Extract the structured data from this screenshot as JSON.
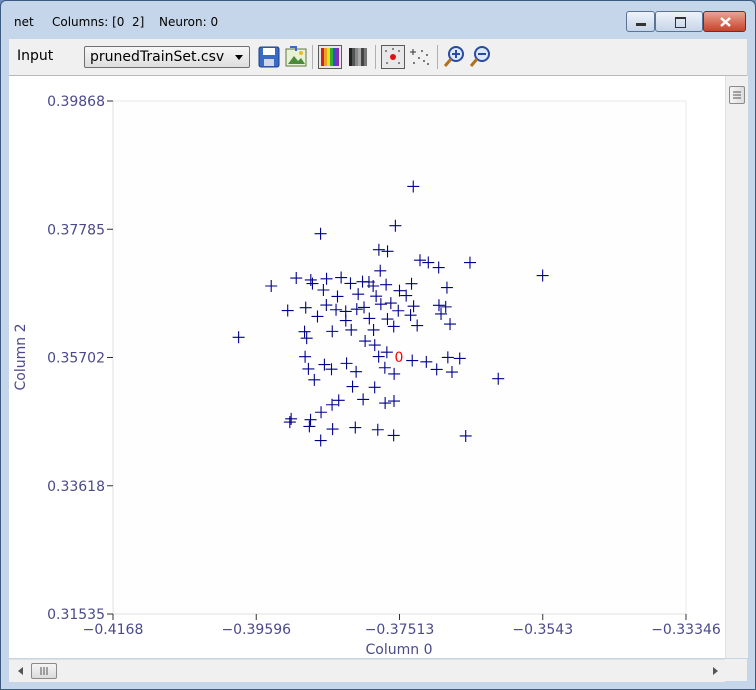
{
  "window": {
    "title_net": "net",
    "title_columns": "Columns: [0  2]",
    "title_neuron": "Neuron: 0"
  },
  "toolbar": {
    "input_label": "Input",
    "file_select_value": "prunedTrainSet.csv",
    "icons": [
      "save-icon",
      "export-image-icon",
      "color-map-icon",
      "grayscale-map-icon",
      "show-neuron-icon",
      "scatter-points-icon",
      "zoom-in-icon",
      "zoom-out-icon"
    ]
  },
  "colors": {
    "points": "#00008b",
    "neuron": "#ff0000",
    "axis_text": "#4a4a8a"
  },
  "chart_data": {
    "type": "scatter",
    "xlabel": "Column 0",
    "ylabel": "Column 2",
    "xlim": [
      -0.4168,
      -0.33346
    ],
    "ylim": [
      0.31535,
      0.39868
    ],
    "x_ticks": [
      "−0.4168",
      "−0.39596",
      "−0.37513",
      "−0.3543",
      "−0.33346"
    ],
    "y_ticks": [
      "0.39868",
      "0.37785",
      "0.35702",
      "0.33618",
      "0.31535"
    ],
    "grid": false,
    "marker": "+",
    "neuron": {
      "label": "0",
      "x": -0.3752,
      "y": 0.3571
    },
    "points": [
      [
        -0.37313,
        0.3848
      ],
      [
        -0.37573,
        0.37842
      ],
      [
        -0.38661,
        0.37712
      ],
      [
        -0.37813,
        0.37452
      ],
      [
        -0.37687,
        0.37426
      ],
      [
        -0.37094,
        0.37244
      ],
      [
        -0.37215,
        0.37282
      ],
      [
        -0.36943,
        0.37163
      ],
      [
        -0.36488,
        0.37243
      ],
      [
        -0.37793,
        0.3711
      ],
      [
        -0.35431,
        0.37033
      ],
      [
        -0.39379,
        0.36863
      ],
      [
        -0.39015,
        0.36992
      ],
      [
        -0.38803,
        0.36961
      ],
      [
        -0.38779,
        0.36902
      ],
      [
        -0.38574,
        0.3698
      ],
      [
        -0.38362,
        0.37
      ],
      [
        -0.38226,
        0.36905
      ],
      [
        -0.38051,
        0.36933
      ],
      [
        -0.37957,
        0.36928
      ],
      [
        -0.37896,
        0.36863
      ],
      [
        -0.37708,
        0.36885
      ],
      [
        -0.37513,
        0.36787
      ],
      [
        -0.37338,
        0.369
      ],
      [
        -0.36823,
        0.36837
      ],
      [
        -0.3862,
        0.36798
      ],
      [
        -0.38415,
        0.36693
      ],
      [
        -0.38114,
        0.3673
      ],
      [
        -0.37853,
        0.36698
      ],
      [
        -0.37416,
        0.36707
      ],
      [
        -0.38877,
        0.36511
      ],
      [
        -0.38577,
        0.36554
      ],
      [
        -0.38436,
        0.36477
      ],
      [
        -0.38295,
        0.3645
      ],
      [
        -0.38134,
        0.36487
      ],
      [
        -0.38029,
        0.36515
      ],
      [
        -0.37784,
        0.36568
      ],
      [
        -0.37639,
        0.36585
      ],
      [
        -0.37308,
        0.36535
      ],
      [
        -0.36939,
        0.3655
      ],
      [
        -0.36841,
        0.36524
      ],
      [
        -0.37531,
        0.36461
      ],
      [
        -0.39139,
        0.36464
      ],
      [
        -0.38706,
        0.36368
      ],
      [
        -0.38294,
        0.36301
      ],
      [
        -0.37952,
        0.36336
      ],
      [
        -0.37688,
        0.36326
      ],
      [
        -0.37352,
        0.36389
      ],
      [
        -0.36909,
        0.36409
      ],
      [
        -0.38894,
        0.36121
      ],
      [
        -0.38491,
        0.36126
      ],
      [
        -0.38215,
        0.3615
      ],
      [
        -0.3789,
        0.36149
      ],
      [
        -0.37597,
        0.36206
      ],
      [
        -0.37256,
        0.36221
      ],
      [
        -0.36778,
        0.36244
      ],
      [
        -0.39853,
        0.3603
      ],
      [
        -0.38863,
        0.36016
      ],
      [
        -0.38013,
        0.35969
      ],
      [
        -0.37873,
        0.35903
      ],
      [
        -0.38886,
        0.35714
      ],
      [
        -0.38605,
        0.35586
      ],
      [
        -0.38283,
        0.35606
      ],
      [
        -0.37816,
        0.35716
      ],
      [
        -0.37697,
        0.35787
      ],
      [
        -0.37328,
        0.35652
      ],
      [
        -0.37123,
        0.35631
      ],
      [
        -0.3681,
        0.35703
      ],
      [
        -0.36637,
        0.35686
      ],
      [
        -0.38838,
        0.35516
      ],
      [
        -0.38502,
        0.35511
      ],
      [
        -0.38144,
        0.35471
      ],
      [
        -0.37726,
        0.35535
      ],
      [
        -0.37591,
        0.35435
      ],
      [
        -0.36972,
        0.35508
      ],
      [
        -0.3675,
        0.35465
      ],
      [
        -0.36077,
        0.35357
      ],
      [
        -0.38752,
        0.35339
      ],
      [
        -0.38196,
        0.35229
      ],
      [
        -0.37874,
        0.35217
      ],
      [
        -0.38397,
        0.35006
      ],
      [
        -0.38494,
        0.34934
      ],
      [
        -0.38042,
        0.35021
      ],
      [
        -0.37722,
        0.34962
      ],
      [
        -0.37593,
        0.34994
      ],
      [
        -0.38654,
        0.34812
      ],
      [
        -0.39089,
        0.34705
      ],
      [
        -0.39108,
        0.34652
      ],
      [
        -0.38807,
        0.34691
      ],
      [
        -0.38824,
        0.34582
      ],
      [
        -0.38486,
        0.34539
      ],
      [
        -0.38156,
        0.34564
      ],
      [
        -0.37829,
        0.34528
      ],
      [
        -0.38659,
        0.34353
      ],
      [
        -0.37598,
        0.34436
      ],
      [
        -0.3655,
        0.34427
      ]
    ]
  }
}
